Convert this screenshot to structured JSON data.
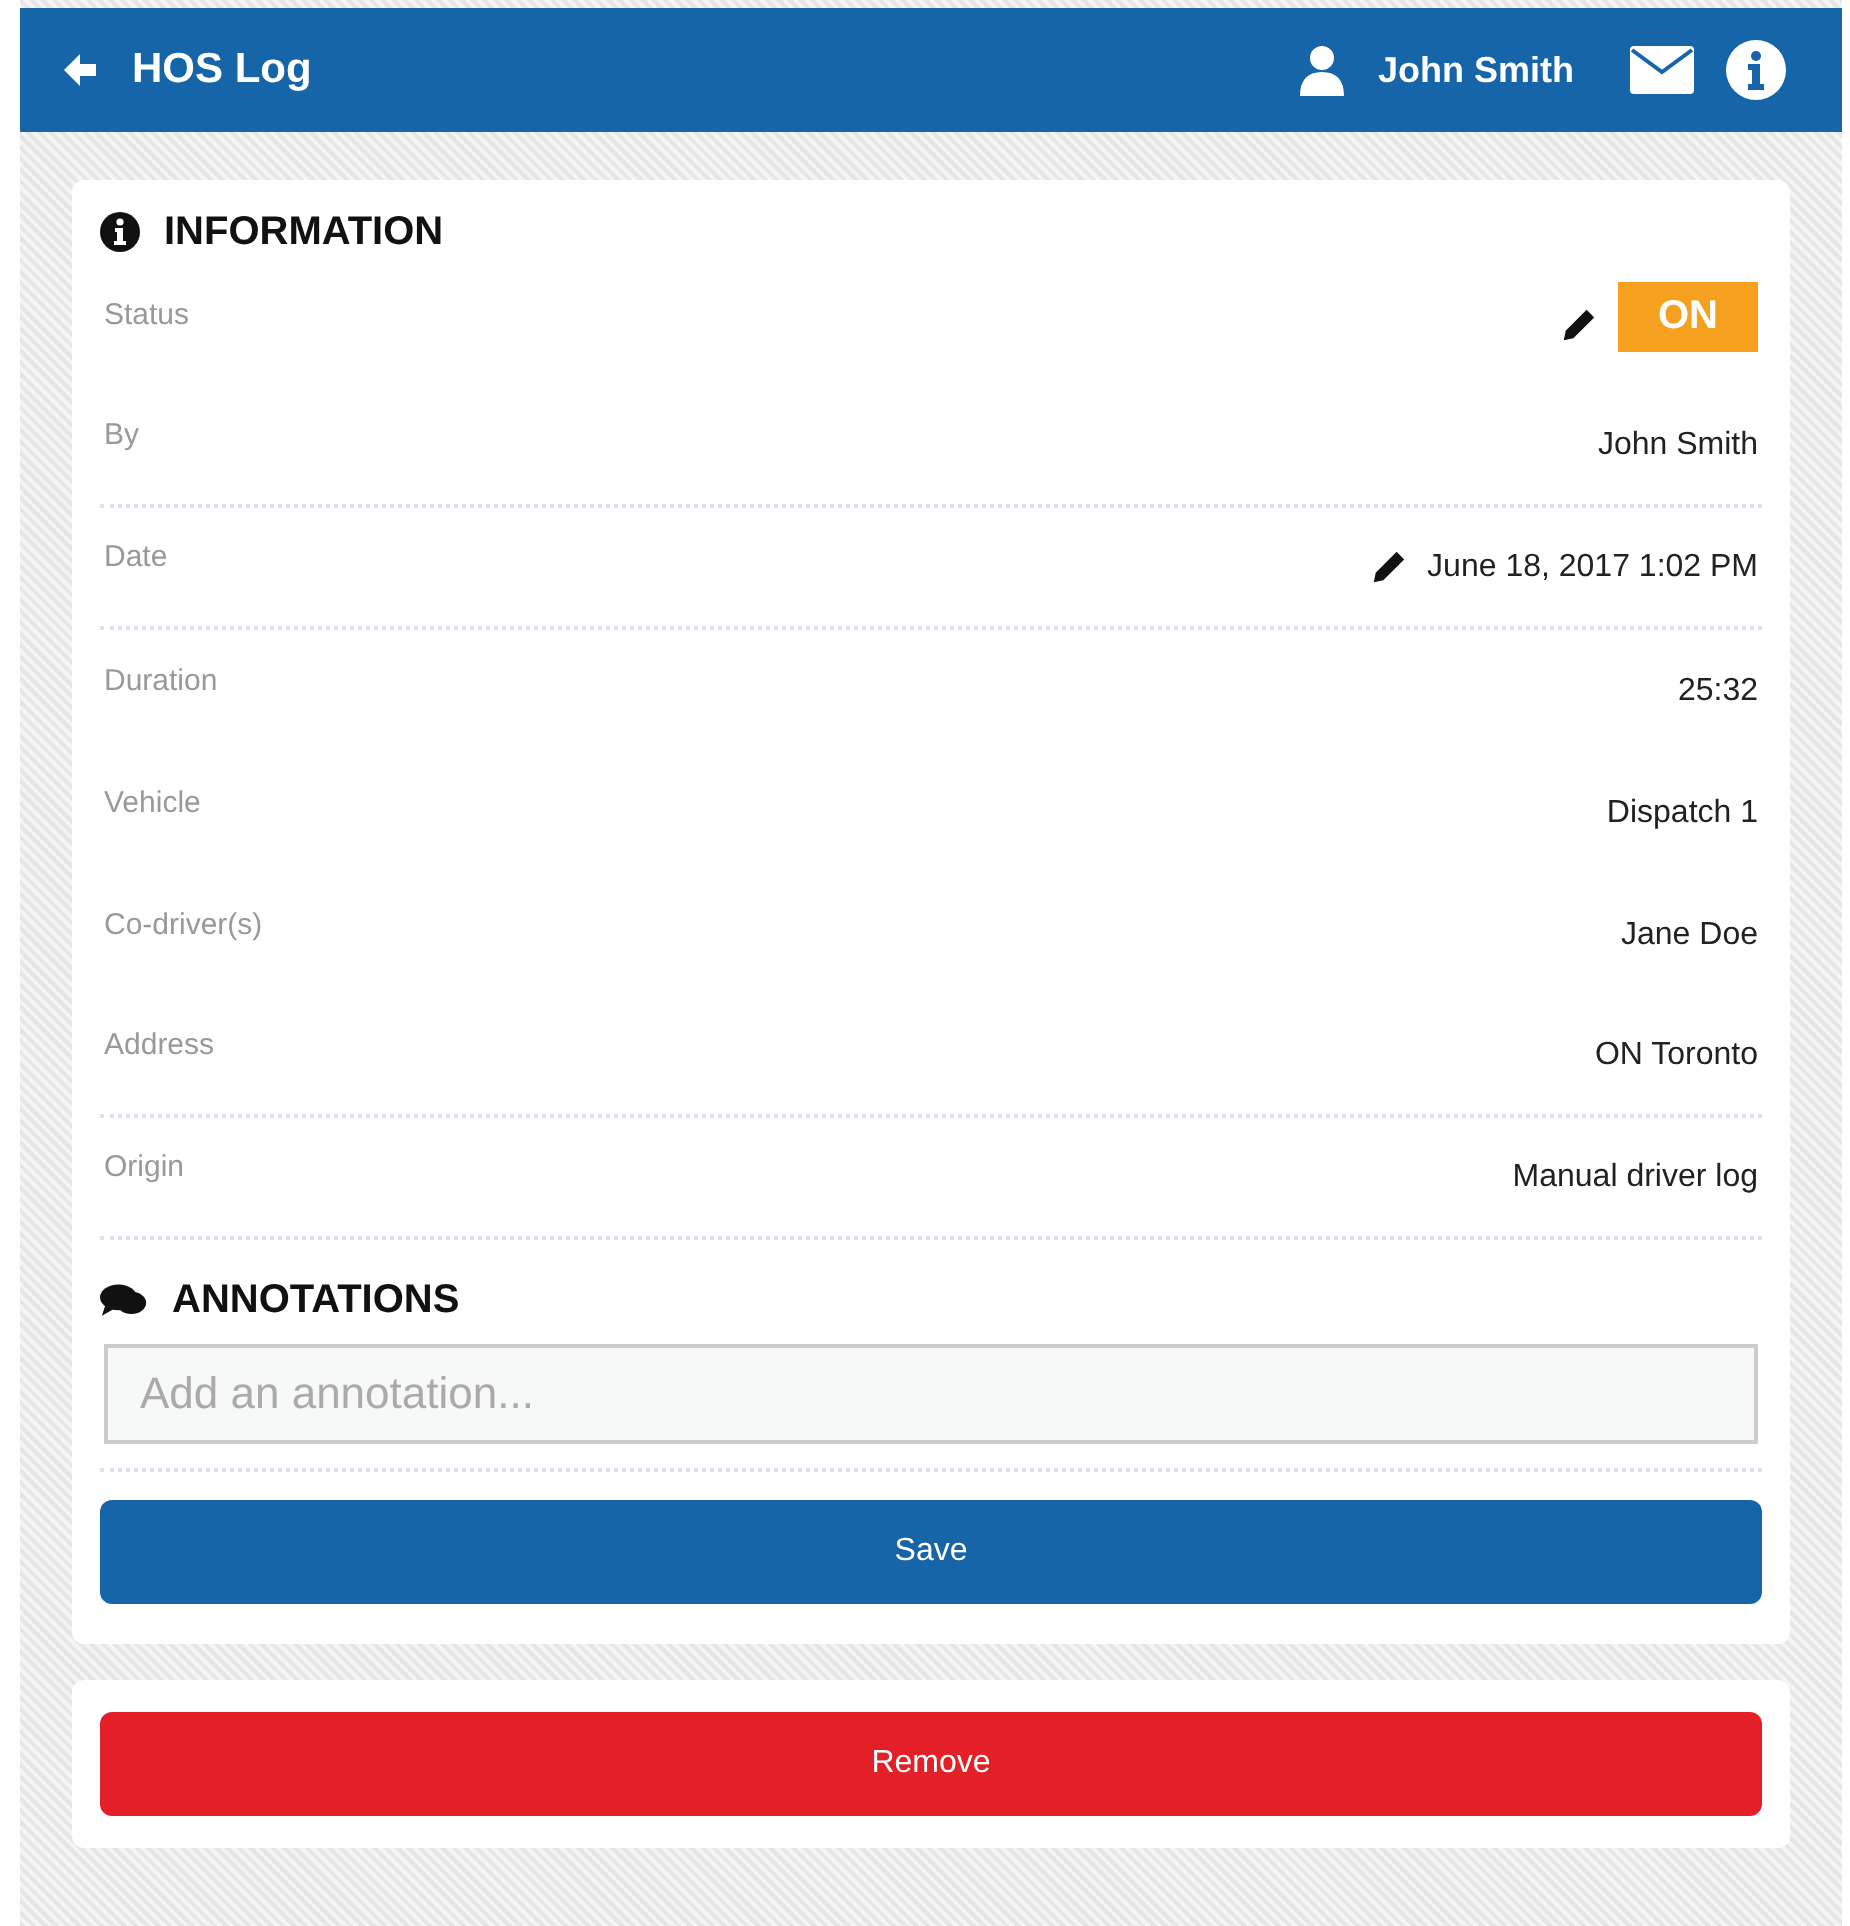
{
  "header": {
    "title": "HOS Log",
    "user": "John Smith"
  },
  "information": {
    "title": "INFORMATION",
    "rows": [
      {
        "label": "Status",
        "value": "ON",
        "kind": "badge",
        "editable": true,
        "divider": false
      },
      {
        "label": "By",
        "value": "John Smith",
        "kind": "text",
        "editable": false,
        "divider": true
      },
      {
        "label": "Date",
        "value": "June 18, 2017 1:02 PM",
        "kind": "text",
        "editable": true,
        "divider": true
      },
      {
        "label": "Duration",
        "value": "25:32",
        "kind": "text",
        "editable": false,
        "divider": false
      },
      {
        "label": "Vehicle",
        "value": "Dispatch 1",
        "kind": "text",
        "editable": false,
        "divider": false
      },
      {
        "label": "Co-driver(s)",
        "value": "Jane Doe",
        "kind": "text",
        "editable": false,
        "divider": false
      },
      {
        "label": "Address",
        "value": "ON Toronto",
        "kind": "text",
        "editable": false,
        "divider": true
      },
      {
        "label": "Origin",
        "value": "Manual driver log",
        "kind": "text",
        "editable": false,
        "divider": true
      }
    ]
  },
  "annotations": {
    "title": "ANNOTATIONS",
    "placeholder": "Add an annotation...",
    "save": "Save"
  },
  "remove": "Remove"
}
